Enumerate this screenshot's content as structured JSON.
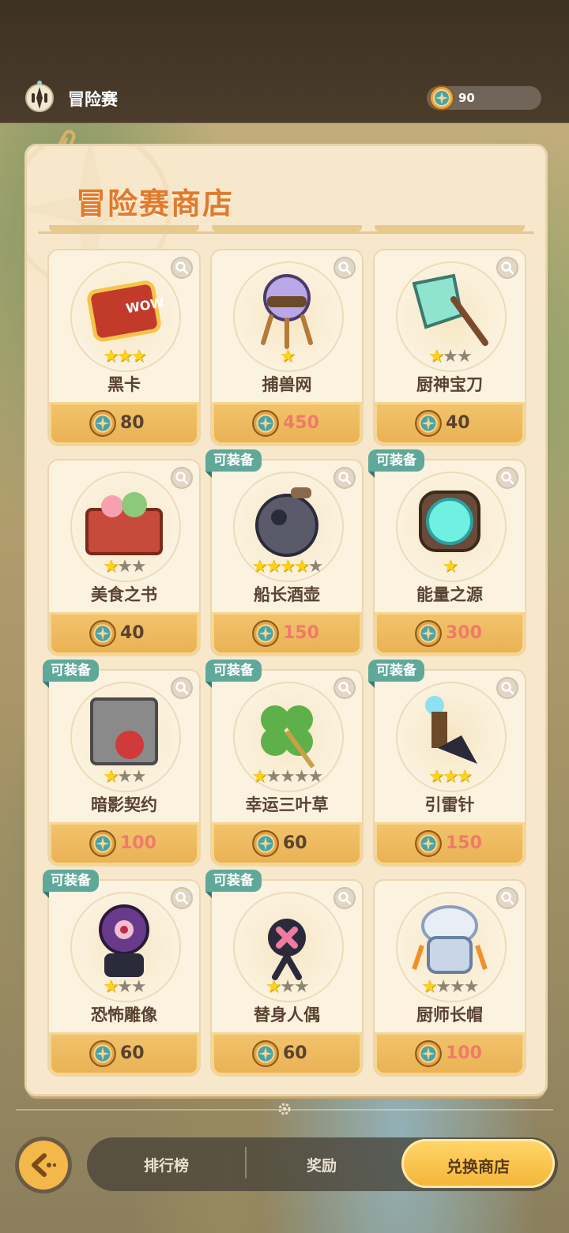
{
  "header": {
    "title": "冒险赛",
    "currency_amount": "90"
  },
  "shop": {
    "title": "冒险赛商店",
    "items": [
      {
        "name": "黑卡",
        "stars_filled": 3,
        "stars_total": 3,
        "price": "80",
        "affordable": true,
        "equippable": false
      },
      {
        "name": "捕兽网",
        "stars_filled": 1,
        "stars_total": 1,
        "price": "450",
        "affordable": false,
        "equippable": false
      },
      {
        "name": "厨神宝刀",
        "stars_filled": 1,
        "stars_total": 3,
        "price": "40",
        "affordable": true,
        "equippable": false
      },
      {
        "name": "美食之书",
        "stars_filled": 1,
        "stars_total": 3,
        "price": "40",
        "affordable": true,
        "equippable": false
      },
      {
        "name": "船长酒壶",
        "stars_filled": 4,
        "stars_total": 5,
        "price": "150",
        "affordable": false,
        "equippable": true
      },
      {
        "name": "能量之源",
        "stars_filled": 1,
        "stars_total": 1,
        "price": "300",
        "affordable": false,
        "equippable": true
      },
      {
        "name": "暗影契约",
        "stars_filled": 1,
        "stars_total": 3,
        "price": "100",
        "affordable": false,
        "equippable": true
      },
      {
        "name": "幸运三叶草",
        "stars_filled": 1,
        "stars_total": 5,
        "price": "60",
        "affordable": true,
        "equippable": true
      },
      {
        "name": "引雷针",
        "stars_filled": 3,
        "stars_total": 3,
        "price": "150",
        "affordable": false,
        "equippable": true
      },
      {
        "name": "恐怖雕像",
        "stars_filled": 1,
        "stars_total": 3,
        "price": "60",
        "affordable": true,
        "equippable": true
      },
      {
        "name": "替身人偶",
        "stars_filled": 1,
        "stars_total": 3,
        "price": "60",
        "affordable": true,
        "equippable": true
      },
      {
        "name": "厨师长帽",
        "stars_filled": 1,
        "stars_total": 4,
        "price": "100",
        "affordable": false,
        "equippable": false
      }
    ],
    "equippable_label": "可装备"
  },
  "nav": {
    "tab_rank": "排行榜",
    "tab_reward": "奖励",
    "tab_shop": "兑换商店"
  },
  "icons": {
    "back": "back-arrow-icon",
    "coin": "coin-icon",
    "zoom": "magnifier-icon"
  },
  "colors": {
    "accent_orange": "#e07a2c",
    "price_short": "#f07a6a",
    "tag_teal": "#5fa89a",
    "active_tab": "#f3b438"
  }
}
